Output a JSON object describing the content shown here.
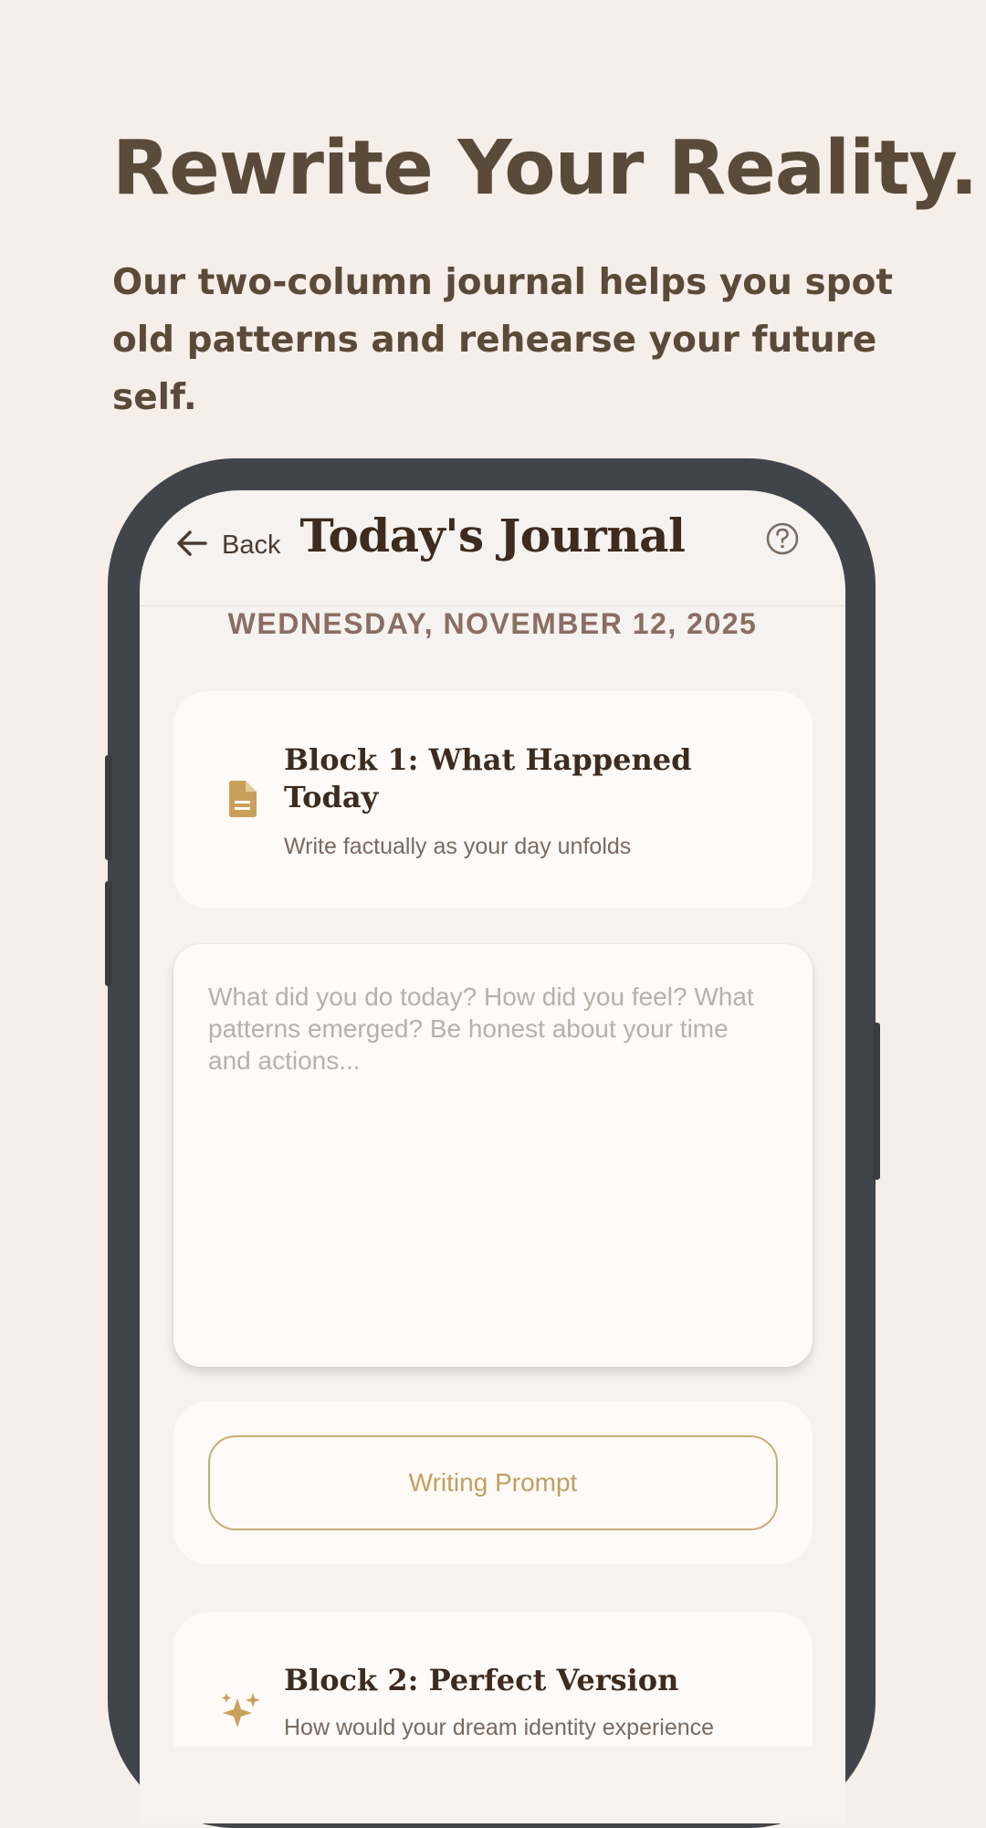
{
  "marketing": {
    "headline": "Rewrite Your Reality.",
    "subhead": "Our two-column journal helps you spot old patterns and rehearse your future self."
  },
  "app": {
    "header": {
      "back_label": "Back",
      "title": "Today's Journal",
      "help_icon": "help-circle-icon",
      "back_icon": "arrow-left-icon"
    },
    "date": "WEDNESDAY, NOVEMBER 12, 2025",
    "block1": {
      "title": "Block 1: What Happened Today",
      "subtitle": "Write factually as your day unfolds",
      "icon": "document-icon",
      "textarea_placeholder": "What did you do today? How did you feel? What patterns emerged? Be honest about your time and actions..."
    },
    "prompt_button": {
      "label": "Writing Prompt"
    },
    "block2": {
      "title": "Block 2: Perfect Version",
      "subtitle": "How would your dream identity experience",
      "icon": "sparkles-icon"
    },
    "colors": {
      "background": "#f5eee9",
      "headline_text": "#5a4a3a",
      "phone_frame": "#42444b",
      "screen_bg": "#f5f2ef",
      "card_bg": "#fdfaf7",
      "accent_gold": "#c9a05a",
      "title_text": "#3d2b1f",
      "date_text": "#8a6e63"
    }
  }
}
